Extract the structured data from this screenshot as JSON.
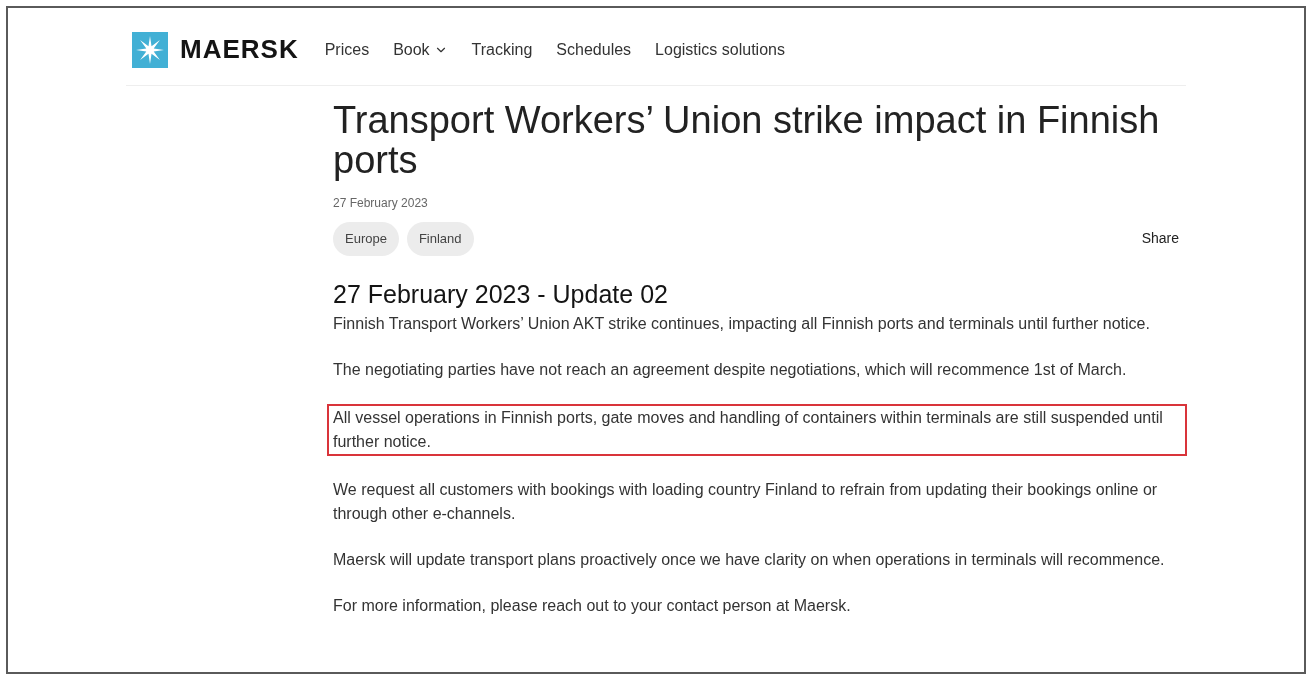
{
  "header": {
    "brand": "MAERSK",
    "nav": [
      {
        "label": "Prices",
        "dropdown": false
      },
      {
        "label": "Book",
        "dropdown": true
      },
      {
        "label": "Tracking",
        "dropdown": false
      },
      {
        "label": "Schedules",
        "dropdown": false
      },
      {
        "label": "Logistics solutions",
        "dropdown": false
      }
    ]
  },
  "article": {
    "title": "Transport Workers’ Union strike impact in Finnish ports",
    "date": "27 February 2023",
    "tags": [
      "Europe",
      "Finland"
    ],
    "share": "Share",
    "section_heading": "27 February 2023 - Update 02",
    "paragraphs": [
      {
        "text": "Finnish Transport Workers’ Union AKT strike continues, impacting all Finnish ports and terminals until further notice.",
        "highlighted": false
      },
      {
        "text": "The negotiating parties have not reach an agreement despite negotiations, which will recommence 1st of March.",
        "highlighted": false
      },
      {
        "text": "All vessel operations in Finnish ports, gate moves and handling of containers within terminals are still suspended until further notice.",
        "highlighted": true
      },
      {
        "text": "We request all customers with bookings with loading country Finland to refrain from updating their bookings online or through other e-channels.",
        "highlighted": false
      },
      {
        "text": "Maersk will update transport plans proactively once we have clarity on when operations in terminals will recommence.",
        "highlighted": false
      },
      {
        "text": "For more information, please reach out to your contact person at Maersk.",
        "highlighted": false
      }
    ]
  }
}
